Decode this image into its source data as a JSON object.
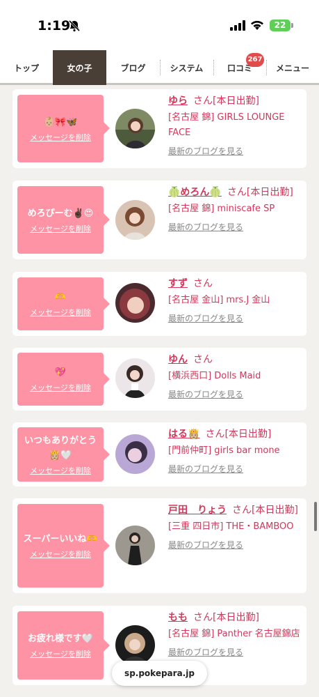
{
  "status": {
    "time": "1:19",
    "battery": "22"
  },
  "nav": {
    "tabs": [
      "トップ",
      "女の子",
      "ブログ",
      "システム",
      "口コミ",
      "メニュー"
    ],
    "active_tab": "女の子",
    "reviews_badge": "267"
  },
  "colors": {
    "accent_pink": "#fd93a4",
    "link_red": "#d2365b",
    "nav_active": "#4a3f36",
    "badge_red": "#e04b4b"
  },
  "cards": [
    {
      "message": "👶🏼🎀🦋",
      "delete_label": "メッセージを削除",
      "name": "ゆら",
      "honorific": "さん",
      "status": "[本日出勤]",
      "shop": "[名古屋 錦] GIRLS LOUNGE FACE",
      "blog_link": "最新のブログを見る"
    },
    {
      "message": "めろぴーむ✌🏿😍",
      "delete_label": "メッセージを削除",
      "name": "🍈めろん🍈",
      "honorific": "さん",
      "status": "[本日出勤]",
      "shop": "[名古屋 錦] miniscafe SP",
      "blog_link": "最新のブログを見る"
    },
    {
      "message": "🫶",
      "delete_label": "メッセージを削除",
      "name": "すず",
      "honorific": "さん",
      "status": "",
      "shop": "[名古屋 金山] mrs.J 金山",
      "blog_link": "最新のブログを見る"
    },
    {
      "message": "💖",
      "delete_label": "メッセージを削除",
      "name": "ゆん",
      "honorific": "さん",
      "status": "",
      "shop": "[横浜西口] Dolls Maid",
      "blog_link": "最新のブログを見る"
    },
    {
      "message": "いつもありがとう👸🏼🤍",
      "delete_label": "メッセージを削除",
      "name": "はる👸🏼",
      "honorific": "さん",
      "status": "[本日出勤]",
      "shop": "[門前仲町] girls bar mone",
      "blog_link": "最新のブログを見る"
    },
    {
      "message": "スーパーいいね🫶",
      "delete_label": "メッセージを削除",
      "name": "戸田　りょう",
      "honorific": "さん",
      "status": "[本日出勤]",
      "shop": "[三重 四日市] THE・BAMBOO",
      "blog_link": "最新のブログを見る"
    },
    {
      "message": "お疲れ様です🤍",
      "delete_label": "メッセージを削除",
      "name": "もも",
      "honorific": "さん",
      "status": "[本日出勤]",
      "shop": "[名古屋 錦] Panther 名古屋錦店",
      "blog_link": "最新のブログを見る"
    }
  ],
  "url": "sp.pokepara.jp"
}
